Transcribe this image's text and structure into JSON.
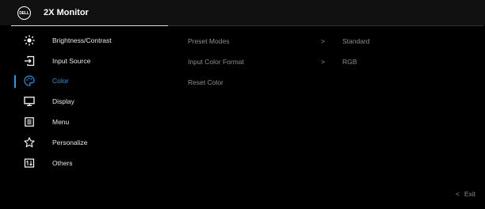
{
  "header": {
    "logo_text": "DELL",
    "title": "2X Monitor"
  },
  "menu": {
    "items": [
      {
        "label": "Brightness/Contrast",
        "icon": "brightness-icon"
      },
      {
        "label": "Input Source",
        "icon": "input-source-icon"
      },
      {
        "label": "Color",
        "icon": "color-palette-icon",
        "active": true
      },
      {
        "label": "Display",
        "icon": "display-monitor-icon"
      },
      {
        "label": "Menu",
        "icon": "menu-icon"
      },
      {
        "label": "Personalize",
        "icon": "star-icon"
      },
      {
        "label": "Others",
        "icon": "others-icon"
      }
    ]
  },
  "submenu": {
    "rows": [
      {
        "label": "Preset Modes",
        "arrow": ">",
        "value": "Standard"
      },
      {
        "label": "Input Color Format",
        "arrow": ">",
        "value": "RGB"
      },
      {
        "label": "Reset Color"
      }
    ]
  },
  "footer": {
    "exit_chevron": "<",
    "exit_label": "Exit"
  },
  "colors": {
    "accent": "#1e9be9",
    "background": "#000000",
    "header": "#111111"
  }
}
